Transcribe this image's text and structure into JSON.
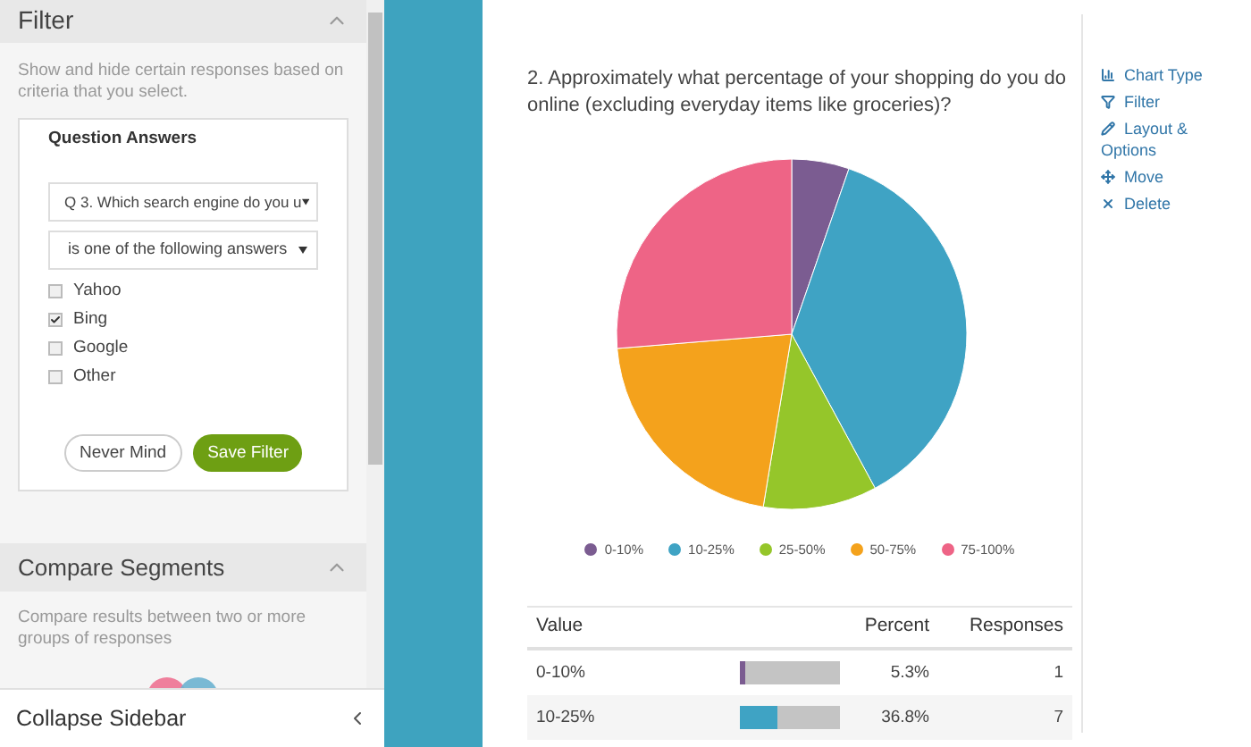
{
  "sidebar": {
    "filter": {
      "title": "Filter",
      "expanded": true,
      "description": "Show and hide certain responses based on criteria that you select.",
      "card_title": "Question Answers",
      "question_select": "Q 3. Which search engine do you u",
      "condition_select": "is one of the following answers",
      "options": [
        {
          "label": "Yahoo",
          "checked": false
        },
        {
          "label": "Bing",
          "checked": true
        },
        {
          "label": "Google",
          "checked": false
        },
        {
          "label": "Other",
          "checked": false
        }
      ],
      "buttons": [
        {
          "label": "Never Mind",
          "kind": "secondary"
        },
        {
          "label": "Save Filter",
          "kind": "primary"
        }
      ]
    },
    "compare": {
      "title": "Compare Segments",
      "expanded": true,
      "description": "Compare results between two or more groups of responses"
    },
    "collapse": "Collapse Sidebar"
  },
  "question": "2. Approximately what percentage of your shopping do you do online (excluding everyday items like groceries)?",
  "chart_data": {
    "type": "pie",
    "categories": [
      "0-10%",
      "10-25%",
      "25-50%",
      "50-75%",
      "75-100%"
    ],
    "values": [
      5.3,
      36.8,
      10.5,
      21.1,
      26.3
    ],
    "colors": [
      "#7b5c91",
      "#3fa3c4",
      "#95c62a",
      "#f4a21c",
      "#ee6486"
    ]
  },
  "actions": [
    "Chart Type",
    "Filter",
    "Layout & Options",
    "Move",
    "Delete"
  ],
  "table": {
    "columns": [
      "Value",
      "Percent",
      "Responses"
    ],
    "rows": [
      {
        "value": "0-10%",
        "level": 0.053,
        "percent": "5.3%",
        "responses": "1"
      },
      {
        "value": "10-25%",
        "level": 0.368,
        "percent": "36.8%",
        "responses": "7"
      }
    ]
  }
}
